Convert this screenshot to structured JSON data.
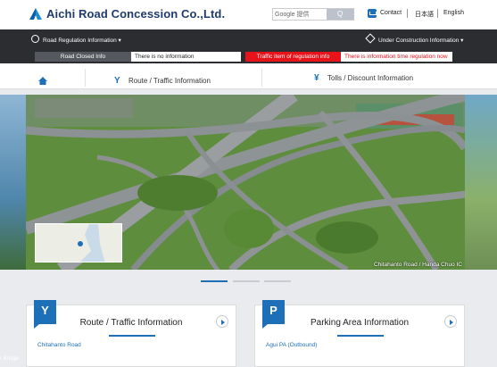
{
  "header": {
    "logo_text": "Aichi Road Concession Co.,Ltd.",
    "search_placeholder": "Google 提供",
    "search_button": "Q",
    "contact_label": "Contact",
    "japanese_label": "日本語",
    "english_label": "English"
  },
  "regulation_bar": {
    "road_regulation_label": "Road Regulation Information",
    "road_closed_label": "Road Closed Info",
    "road_closed_value": "There is no information",
    "under_construction_label": "Under Construction Information",
    "traffic_item_label": "Traffic item of regulation info",
    "traffic_item_value": "There is information time regulation now"
  },
  "nav": {
    "home_icon": "home-icon",
    "route_label": "Route / Traffic Information",
    "tolls_label": "Tolls / Discount Information"
  },
  "hero": {
    "caption": "Chitahanto Road / Handa Chuo IC",
    "left_caption": "r Bridge"
  },
  "cards": [
    {
      "badge": "Y",
      "title": "Route / Traffic Information",
      "first_link": "Chitahanto Road"
    },
    {
      "badge": "P",
      "title": "Parking Area Information",
      "first_link": "Agui PA (Outbound)"
    }
  ],
  "colors": {
    "accent": "#1d6fb8",
    "dark_bar": "#2b2d31",
    "alert": "#e8121b"
  }
}
